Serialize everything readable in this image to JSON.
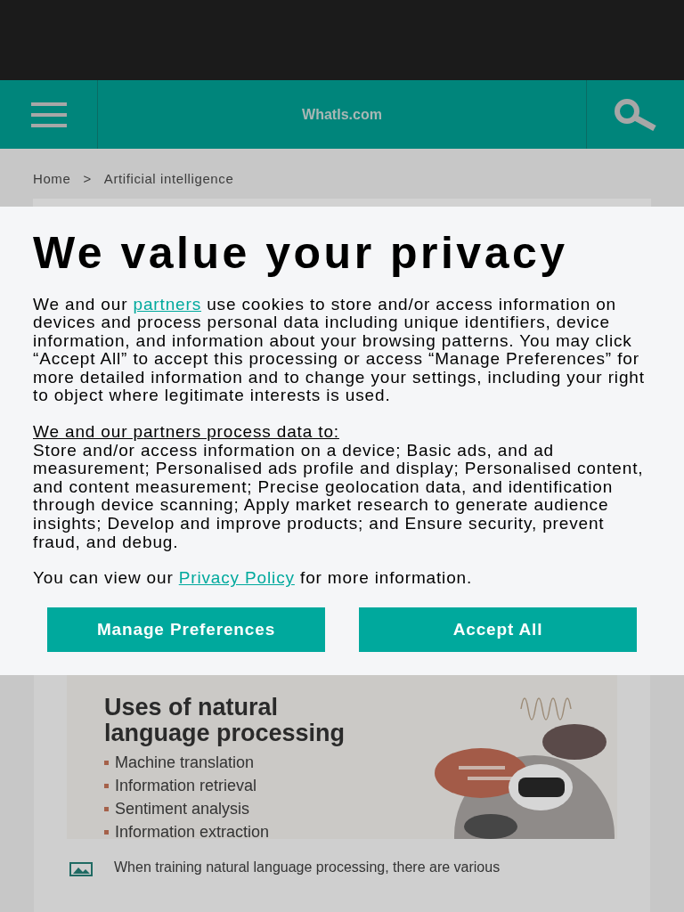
{
  "header": {
    "site_title": "WhatIs.com"
  },
  "breadcrumb": [
    {
      "label": "Home"
    },
    {
      "label": ">"
    },
    {
      "label": "Artificial intelligence"
    }
  ],
  "consent_dialog": {
    "title": "We value your privacy",
    "intro": {
      "before": "We and our ",
      "link": "partners",
      "after": " use cookies to store and/or access information on devices and process personal data including unique identifiers, device information, and information about your browsing patterns. You may click “Accept All” to accept this processing or access “Manage Preferences” for more detailed information and to change your settings, including your right to object where legitimate interests is used."
    },
    "purposes_heading": "We and our partners process data to:",
    "purposes": "Store and/or access information on a device; Basic ads, and ad measurement; Personalised ads profile and display; Personalised content, and content measurement; Precise geolocation data, and identification through device scanning; Apply market research to generate audience insights; Develop and improve products; and Ensure security, prevent fraud, and debug.",
    "policy": {
      "before": "You can view our ",
      "link": "Privacy Policy",
      "after": " for more information."
    },
    "buttons": [
      {
        "label": "Manage Preferences"
      },
      {
        "label": "Accept All"
      }
    ]
  },
  "infographic": {
    "title_lines": [
      "Uses of natural",
      "language processing"
    ],
    "items": [
      "Machine translation",
      "Information retrieval",
      "Sentiment analysis",
      "Information extraction"
    ]
  },
  "caption": "When training natural language processing, there are various"
}
